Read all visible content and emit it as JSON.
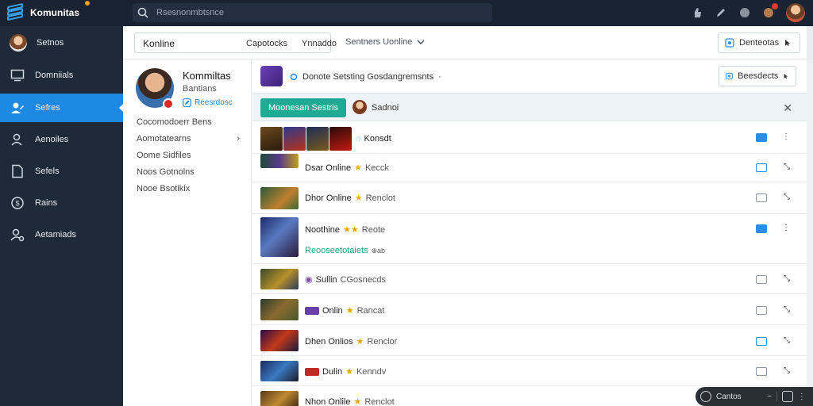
{
  "topbar": {
    "brand": "Komunitas",
    "search_placeholder": "Rsesnonmbtsnce"
  },
  "sidebar": {
    "items": [
      {
        "label": "Setnos",
        "icon": "avatar"
      },
      {
        "label": "Domniials",
        "icon": "monitor-icon"
      },
      {
        "label": "Sefres",
        "icon": "user-edit-icon"
      },
      {
        "label": "Aenoiles",
        "icon": "user-icon"
      },
      {
        "label": "Sefels",
        "icon": "folder-icon"
      },
      {
        "label": "Rains",
        "icon": "dollar-circle-icon"
      },
      {
        "label": "Aetamiads",
        "icon": "person-gear-icon"
      }
    ]
  },
  "subheader": {
    "tab_active": "Konline",
    "tab_2": "Capotocks",
    "tab_3": "Ynnaddo",
    "filter": "Sentners Uonline",
    "action": "Denteotas"
  },
  "profile": {
    "name": "Kommiltas",
    "subtitle": "Bantians",
    "link": "Reesrdosc",
    "rows": [
      "Cocomodoerr Bens",
      "Aomotatearns",
      "Oome Sidfiles",
      "Noos Gotnolns",
      "Nooe Bsotikix"
    ]
  },
  "main": {
    "header_title": "Donote Setsting Gosdangremsnts",
    "header_button": "Beesdects",
    "primary_button": "Moonesan Sestris",
    "user_name": "Sadnoi",
    "rows": [
      {
        "text": "Konsdt",
        "extra": ""
      },
      {
        "text": "Dsar Online",
        "extra": "Kecck"
      },
      {
        "text": "Dhor Online",
        "extra": "Renclot"
      },
      {
        "text": "Noothine",
        "extra": "Reote",
        "sub": "Reooseetotaiets",
        "sub2": "⊕ab"
      },
      {
        "text": "Sullin",
        "extra": "CGosnecds"
      },
      {
        "text": "Onlin",
        "extra": "Rancat"
      },
      {
        "text": "Dhen Onlios",
        "extra": "Renclor"
      },
      {
        "text": "Dulin",
        "extra": "Kenndv"
      },
      {
        "text": "Nhon Onlile",
        "extra": "Renclot"
      }
    ]
  },
  "player": {
    "label": "Cantos"
  },
  "colors": {
    "accent": "#1e88e5",
    "teal": "#1faa94",
    "sidebar": "#1f2a38",
    "topbar": "#1a2332"
  }
}
